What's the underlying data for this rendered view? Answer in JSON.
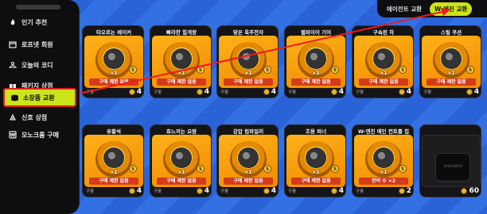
{
  "sidebar": {
    "items": [
      {
        "label": "인기 추천",
        "icon": "fire-icon"
      },
      {
        "label": "로프넷 회원",
        "icon": "calendar-icon"
      },
      {
        "label": "오늘의 코디",
        "icon": "hanger-icon"
      },
      {
        "label": "패키지 상점",
        "icon": "gift-icon"
      },
      {
        "label": "소장품 교환",
        "icon": "coins-icon"
      },
      {
        "label": "신호 상점",
        "icon": "signal-icon"
      },
      {
        "label": "모노크롬 구매",
        "icon": "currency-icon"
      }
    ],
    "active_index": 4
  },
  "tabs": [
    {
      "label": "에이전트 교환",
      "active": false
    },
    {
      "label": "W-엔진 교환",
      "active": true
    }
  ],
  "cards": [
    {
      "title": "타오르는 레이커",
      "qty": "×1",
      "tag": "구매 제한 없음",
      "badge": "구꽃",
      "price": "4"
    },
    {
      "title": "빠라한 힘개랑",
      "qty": "×1",
      "tag": "구매 제한 없음",
      "badge": "구꽃",
      "price": "4"
    },
    {
      "title": "맞은 옥주전자",
      "qty": "×1",
      "tag": "구매 제한 없음",
      "badge": "구꽃",
      "price": "4"
    },
    {
      "title": "웹파이어 기어",
      "qty": "×1",
      "tag": "구매 제한 없음",
      "badge": "구꽃",
      "price": "4"
    },
    {
      "title": "구속된 차",
      "qty": "×1",
      "tag": "구매 제한 없음",
      "badge": "구꽃",
      "price": "4"
    },
    {
      "title": "스틸 쿠션",
      "qty": "×1",
      "tag": "구매 제한 없음",
      "badge": "구꽃",
      "price": "4"
    },
    {
      "title": "유황석",
      "qty": "×1",
      "tag": "구매 제한 없음",
      "badge": "구꽃",
      "price": "4"
    },
    {
      "title": "흐느끼는 요람",
      "qty": "×1",
      "tag": "구매 제한 없음",
      "badge": "구꽃",
      "price": "4"
    },
    {
      "title": "강압 컴파일러",
      "qty": "×1",
      "tag": "구매 제한 없음",
      "badge": "구꽃",
      "price": "4"
    },
    {
      "title": "조용 퍼너",
      "qty": "×1",
      "tag": "구매 제한 없음",
      "badge": "구꽃",
      "price": "4"
    },
    {
      "title": "W-엔진 에인 컨트롤 칩",
      "qty": "×1",
      "tag": "잔여 수 ×2",
      "badge": "구꽃",
      "price": "2"
    },
    {
      "title": "",
      "qty": "",
      "tag": "",
      "badge": "",
      "price": "60"
    }
  ],
  "colors": {
    "accent": "#cde31a",
    "highlight_border": "#e02020",
    "item_bg": "#f59a0a",
    "background": "#2a62d8"
  }
}
